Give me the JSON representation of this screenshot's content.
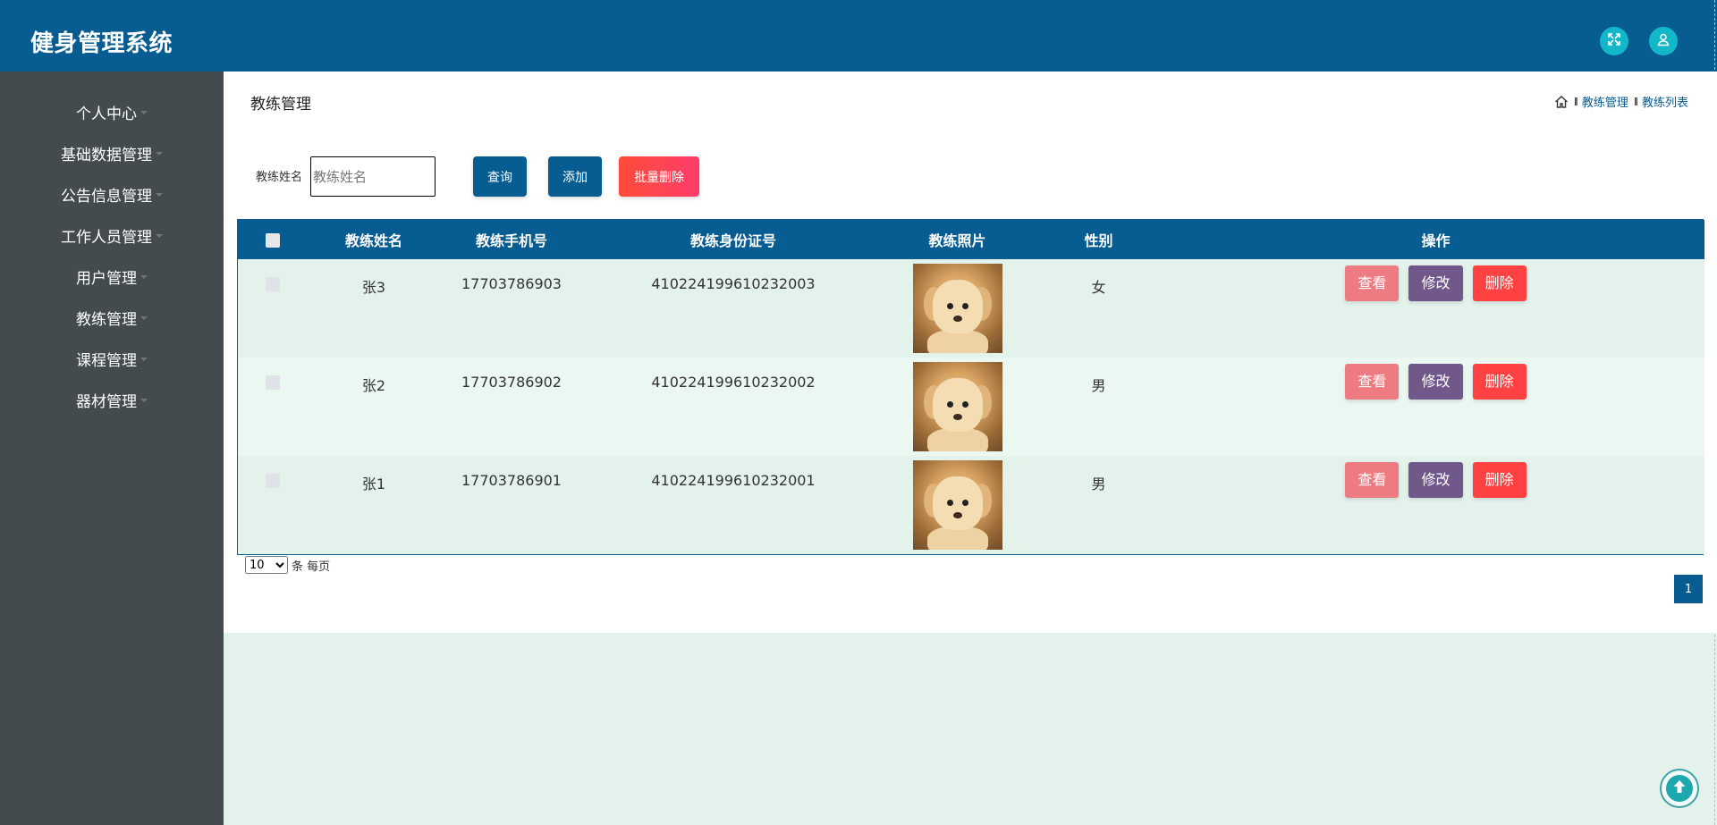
{
  "app": {
    "title": "健身管理系统"
  },
  "sidebar": {
    "items": [
      {
        "label": "个人中心"
      },
      {
        "label": "基础数据管理"
      },
      {
        "label": "公告信息管理"
      },
      {
        "label": "工作人员管理"
      },
      {
        "label": "用户管理"
      },
      {
        "label": "教练管理"
      },
      {
        "label": "课程管理"
      },
      {
        "label": "器材管理"
      }
    ]
  },
  "page": {
    "title": "教练管理",
    "breadcrumb": [
      "教练管理",
      "教练列表"
    ],
    "breadcrumb_sep": "II"
  },
  "search": {
    "label": "教练姓名",
    "placeholder": "教练姓名",
    "value": ""
  },
  "toolbar": {
    "query_label": "查询",
    "add_label": "添加",
    "bulk_delete_label": "批量删除"
  },
  "table": {
    "columns": [
      "教练姓名",
      "教练手机号",
      "教练身份证号",
      "教练照片",
      "性别",
      "操作"
    ],
    "rows": [
      {
        "name": "张3",
        "phone": "17703786903",
        "id_card": "410224199610232003",
        "gender": "女"
      },
      {
        "name": "张2",
        "phone": "17703786902",
        "id_card": "410224199610232002",
        "gender": "男"
      },
      {
        "name": "张1",
        "phone": "17703786901",
        "id_card": "410224199610232001",
        "gender": "男"
      }
    ],
    "actions": {
      "view": "查看",
      "edit": "修改",
      "delete": "删除"
    }
  },
  "pagination": {
    "page_size": "10",
    "page_size_suffix": "条 每页",
    "current_page": "1"
  },
  "colors": {
    "primary": "#075c91",
    "sidebar": "#434b4f",
    "view": "#ef7b82",
    "edit": "#71588a",
    "delete": "#ff4141",
    "accent": "#12b7c9"
  },
  "icons": {
    "fullscreen": "fullscreen-icon",
    "user": "user-icon",
    "home": "home-icon",
    "back_to_top": "arrow-up-icon"
  }
}
